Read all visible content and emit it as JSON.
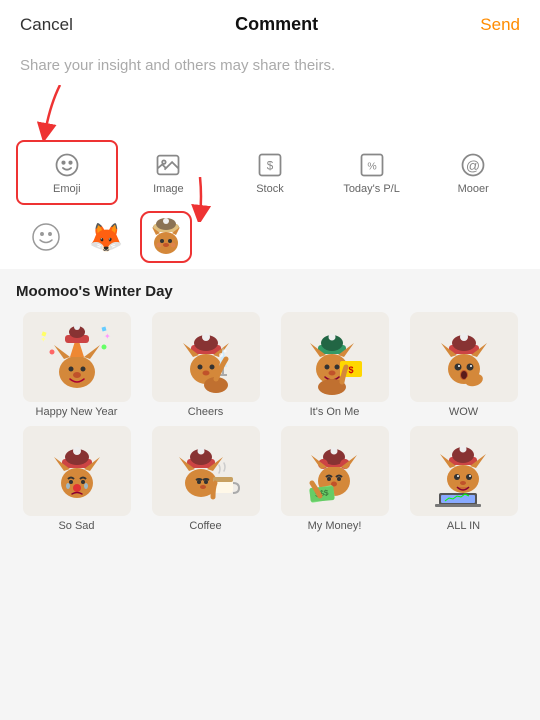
{
  "header": {
    "cancel_label": "Cancel",
    "title": "Comment",
    "send_label": "Send"
  },
  "placeholder": {
    "text": "Share your insight and others may share theirs."
  },
  "toolbar": {
    "items": [
      {
        "id": "emoji",
        "label": "Emoji",
        "icon": "emoji",
        "selected": true
      },
      {
        "id": "image",
        "label": "Image",
        "icon": "image",
        "selected": false
      },
      {
        "id": "stock",
        "label": "Stock",
        "icon": "stock",
        "selected": false
      },
      {
        "id": "pnl",
        "label": "Today's P/L",
        "icon": "pnl",
        "selected": false
      },
      {
        "id": "mooer",
        "label": "Mooer",
        "icon": "at",
        "selected": false
      }
    ]
  },
  "emoji_row": {
    "items": [
      {
        "id": "smiley",
        "emoji": "☺",
        "selected": false
      },
      {
        "id": "fire-fox",
        "emoji": "🦊",
        "selected": false
      },
      {
        "id": "winter-fox",
        "emoji": "🐨",
        "selected": true
      }
    ]
  },
  "sticker_section": {
    "title": "Moomoo's Winter Day",
    "stickers": [
      {
        "id": "happy-new-year",
        "label": "Happy New Year"
      },
      {
        "id": "cheers",
        "label": "Cheers"
      },
      {
        "id": "its-on-me",
        "label": "It's On Me"
      },
      {
        "id": "wow",
        "label": "WOW"
      },
      {
        "id": "so-sad",
        "label": "So Sad"
      },
      {
        "id": "coffee",
        "label": "Coffee"
      },
      {
        "id": "my-money",
        "label": "My Money!"
      },
      {
        "id": "all-in",
        "label": "ALL IN"
      }
    ]
  },
  "colors": {
    "accent": "#FF8C00",
    "red_border": "#e33333",
    "arrow_red": "#e33333",
    "bg_sticker": "#f5f5f5",
    "toolbar_icon": "#888888"
  }
}
